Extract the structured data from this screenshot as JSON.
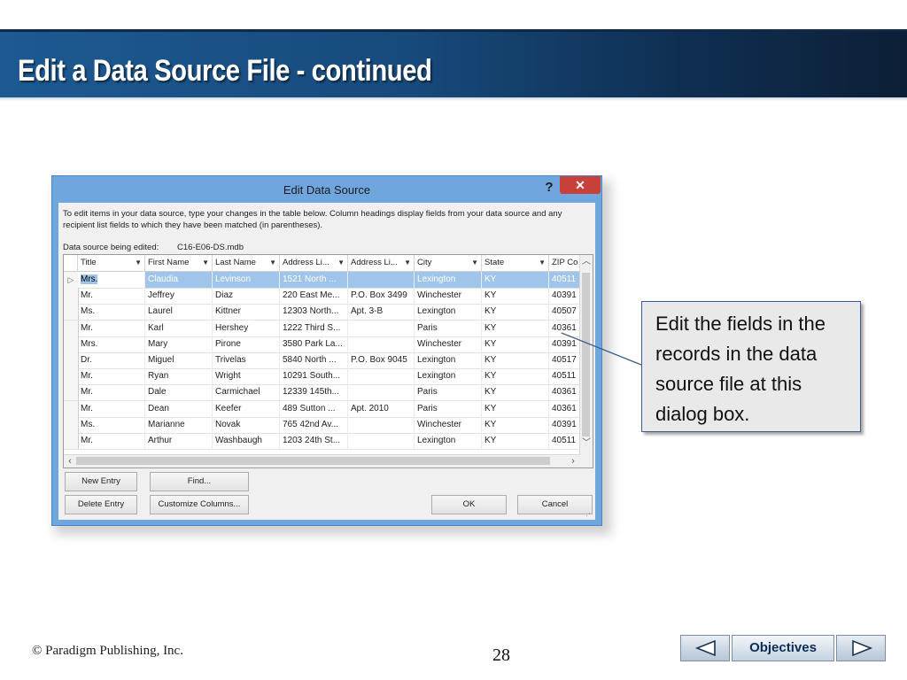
{
  "slide": {
    "title": "Edit a Data Source File - continued",
    "copyright": "© Paradigm Publishing, Inc.",
    "page_number": "28",
    "nav": {
      "objectives_label": "Objectives"
    }
  },
  "dialog": {
    "title": "Edit Data Source",
    "help": "?",
    "close": "✕",
    "instructions": "To edit items in your data source, type your changes in the table below. Column headings display fields from your data source and any recipient list fields to which they have been matched (in parentheses).",
    "source_label": "Data source being edited:",
    "source_name": "C16-E06-DS.mdb",
    "columns": [
      "Title",
      "First Name",
      "Last Name",
      "Address Li...",
      "Address Li...",
      "City",
      "State",
      "ZIP Co"
    ],
    "rows": [
      [
        "Mrs.",
        "Claudia",
        "Levinson",
        "1521 North ...",
        "",
        "Lexington",
        "KY",
        "40511"
      ],
      [
        "Mr.",
        "Jeffrey",
        "Diaz",
        "220 East Me...",
        "P.O. Box 3499",
        "Winchester",
        "KY",
        "40391"
      ],
      [
        "Ms.",
        "Laurel",
        "Kittner",
        "12303 North...",
        "Apt. 3-B",
        "Lexington",
        "KY",
        "40507"
      ],
      [
        "Mr.",
        "Karl",
        "Hershey",
        "1222 Third S...",
        "",
        "Paris",
        "KY",
        "40361"
      ],
      [
        "Mrs.",
        "Mary",
        "Pirone",
        "3580 Park La...",
        "",
        "Winchester",
        "KY",
        "40391"
      ],
      [
        "Dr.",
        "Miguel",
        "Trivelas",
        "5840 North ...",
        "P.O. Box 9045",
        "Lexington",
        "KY",
        "40517"
      ],
      [
        "Mr.",
        "Ryan",
        "Wright",
        "10291 South...",
        "",
        "Lexington",
        "KY",
        "40511"
      ],
      [
        "Mr.",
        "Dale",
        "Carmichael",
        "12339 145th...",
        "",
        "Paris",
        "KY",
        "40361"
      ],
      [
        "Mr.",
        "Dean",
        "Keefer",
        "489 Sutton ...",
        "Apt. 2010",
        "Paris",
        "KY",
        "40361"
      ],
      [
        "Ms.",
        "Marianne",
        "Novak",
        "765 42nd Av...",
        "",
        "Winchester",
        "KY",
        "40391"
      ],
      [
        "Mr.",
        "Arthur",
        "Washbaugh",
        "1203 24th St...",
        "",
        "Lexington",
        "KY",
        "40511"
      ]
    ],
    "selected_row": 0,
    "buttons": {
      "new_entry": "New Entry",
      "find": "Find...",
      "delete_entry": "Delete Entry",
      "customize_columns": "Customize Columns...",
      "ok": "OK",
      "cancel": "Cancel"
    }
  },
  "callout": {
    "text": "Edit the fields in the records in the data source file at this dialog box."
  },
  "colors": {
    "banner": "#174a7c",
    "dialog_frame": "#6fa6dd",
    "close": "#c7403a",
    "selection": "#9fc5ea"
  }
}
